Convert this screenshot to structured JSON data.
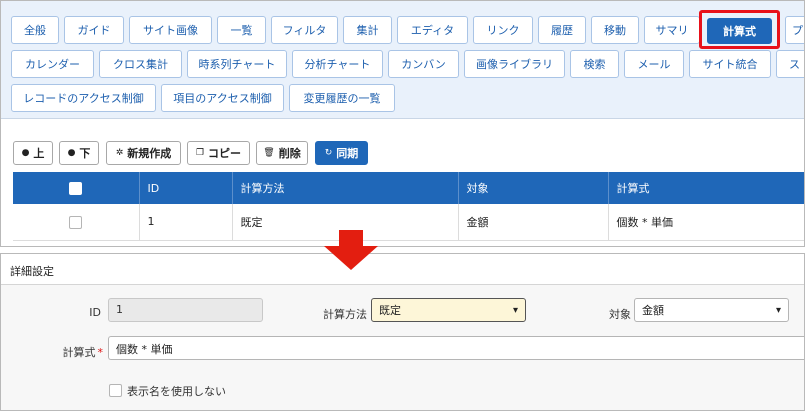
{
  "tabs": [
    {
      "label": "全般"
    },
    {
      "label": "ガイド"
    },
    {
      "label": "サイト画像"
    },
    {
      "label": "一覧"
    },
    {
      "label": "フィルタ"
    },
    {
      "label": "集計"
    },
    {
      "label": "エディタ"
    },
    {
      "label": "リンク"
    },
    {
      "label": "履歴"
    },
    {
      "label": "移動"
    },
    {
      "label": "サマリ"
    },
    {
      "label": "計算式",
      "active": true
    },
    {
      "label": "プロ"
    },
    {
      "label": "カレンダー"
    },
    {
      "label": "クロス集計"
    },
    {
      "label": "時系列チャート"
    },
    {
      "label": "分析チャート"
    },
    {
      "label": "カンバン"
    },
    {
      "label": "画像ライブラリ"
    },
    {
      "label": "検索"
    },
    {
      "label": "メール"
    },
    {
      "label": "サイト統合"
    },
    {
      "label": "ス"
    },
    {
      "label": "レコードのアクセス制御"
    },
    {
      "label": "項目のアクセス制御"
    },
    {
      "label": "変更履歴の一覧"
    }
  ],
  "toolbar": {
    "up": "上",
    "down": "下",
    "create": "新規作成",
    "copy": "コピー",
    "delete": "削除",
    "sync": "同期"
  },
  "grid": {
    "columns": [
      "ID",
      "計算方法",
      "対象",
      "計算式"
    ],
    "rows": [
      {
        "id": "1",
        "method": "既定",
        "target": "金額",
        "formula": "個数 * 単価"
      }
    ]
  },
  "detail": {
    "title": "詳細設定",
    "id_label": "ID",
    "id_value": "1",
    "method_label": "計算方法",
    "method_value": "既定",
    "target_label": "対象",
    "target_value": "金額",
    "formula_label": "計算式",
    "formula_required": "*",
    "formula_value": "個数 * 単価",
    "no_display_name_label": "表示名を使用しない"
  },
  "colors": {
    "primary": "#1f67b8",
    "tab_border": "#a9c4e6",
    "highlight": "#e8111a",
    "arrow": "#e31e10",
    "changed_field": "#fdf6d8"
  }
}
